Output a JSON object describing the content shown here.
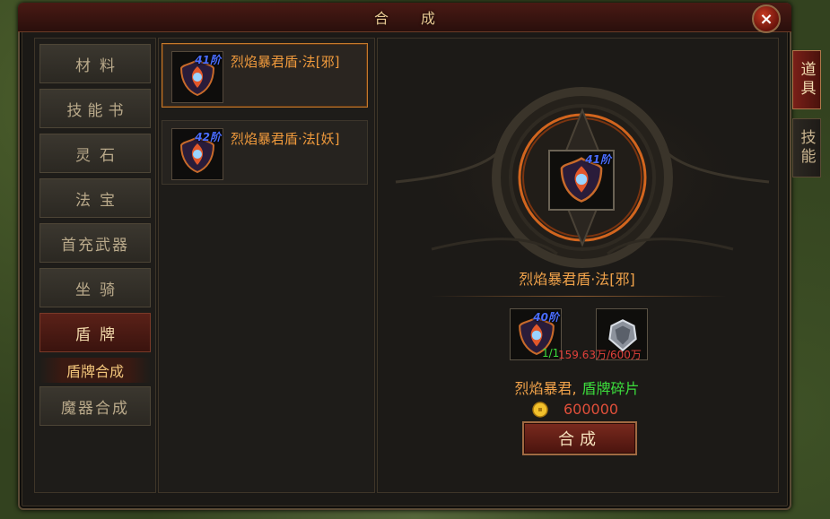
{
  "window": {
    "title": "合成",
    "close_label": "×"
  },
  "categories": [
    {
      "label": "材料",
      "active": false
    },
    {
      "label": "技能书",
      "active": false
    },
    {
      "label": "灵石",
      "active": false
    },
    {
      "label": "法宝",
      "active": false
    },
    {
      "label": "首充武器",
      "active": false
    },
    {
      "label": "坐骑",
      "active": false
    },
    {
      "label": "盾牌",
      "active": true
    },
    {
      "label": "魔器合成",
      "active": false
    }
  ],
  "sub_category": {
    "label": "盾牌合成"
  },
  "items": [
    {
      "name": "烈焰暴君盾·法[邪]",
      "tier": "41阶",
      "selected": true
    },
    {
      "name": "烈焰暴君盾·法[妖]",
      "tier": "42阶",
      "selected": false
    }
  ],
  "detail": {
    "result_tier": "41阶",
    "result_name": "烈焰暴君盾·法[邪]",
    "material_1_tier": "40阶",
    "material_1_count": "1/1",
    "material_2_count": "159.63万/600万",
    "materials_text_1": "烈焰暴君,",
    "materials_text_2": "盾牌碎片",
    "cost": "600000",
    "compose_label": "合成"
  },
  "side_tabs": [
    {
      "label": "道具",
      "active": true
    },
    {
      "label": "技能",
      "active": false
    }
  ],
  "colors": {
    "accent_orange": "#f09a3c",
    "tier_blue": "#4a6dff",
    "ok_green": "#3cdc3c",
    "warn_red": "#e0403a"
  }
}
